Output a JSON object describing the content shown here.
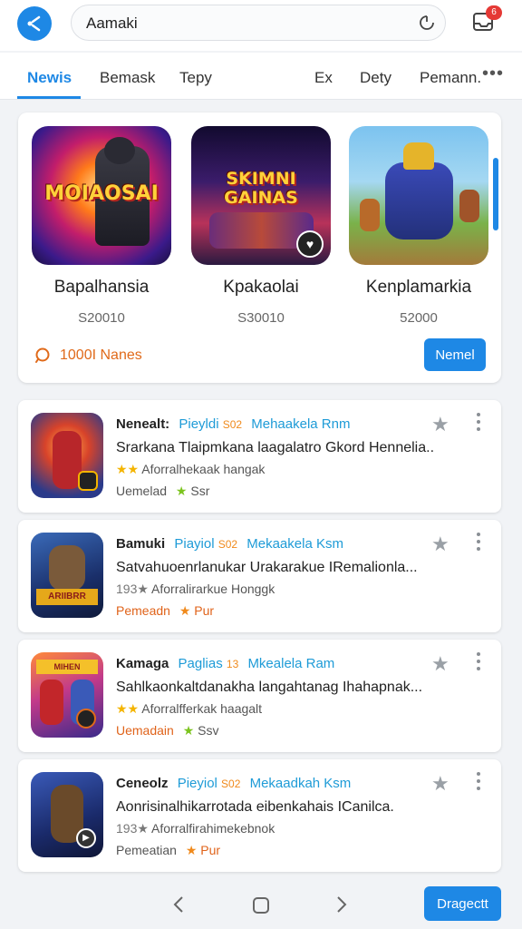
{
  "header": {
    "search_text": "Aamaki",
    "notification_count": "6"
  },
  "tabs": [
    {
      "label": "Newis"
    },
    {
      "label": "Bemask"
    },
    {
      "label": "Tepy"
    },
    {
      "label": "Ex"
    },
    {
      "label": "Dety"
    },
    {
      "label": "Pemann."
    }
  ],
  "featured": {
    "items": [
      {
        "title": "Bapalhansia",
        "price": "S20010",
        "art_text": "MOIAOSAI"
      },
      {
        "title": "Kpakaolai",
        "price": "S30010",
        "art_text": "SKIMNI GAINAS"
      },
      {
        "title": "Kenplamarkia",
        "price": "52000",
        "art_text": ""
      }
    ],
    "names_label": "1000I Nanes",
    "button_label": "Nemel"
  },
  "list": [
    {
      "name": "Nenealt:",
      "tag": "Pieyldi",
      "tag_num": "S02",
      "tag2": "Mehaakela Rnm",
      "description": "Srarkana Tlaipmkana laagalatro Gkord Hennelia...",
      "rating_prefix": "★★",
      "meta": "Aforralhekaak hangak",
      "status": "Uemelad",
      "status_color": "#555555",
      "badge_star": "★",
      "badge_star_color": "#7cc41f",
      "badge": "Ssr"
    },
    {
      "name": "Bamuki",
      "tag": "Piayiol",
      "tag_num": "S02",
      "tag2": "Mekaakela Ksm",
      "description": "Satvahuoenrlanukar Urakarakue IRemalionla...",
      "rating_prefix": "193★",
      "meta": "Aforralirarkue Honggk",
      "status": "Pemeadn",
      "status_color": "#e0631a",
      "badge_star": "★",
      "badge_star_color": "#f08a1c",
      "badge": "Pur"
    },
    {
      "name": "Kamaga",
      "tag": "Paglias",
      "tag_num": "13",
      "tag2": "Mkealela Ram",
      "description": "Sahlkaonkaltdanakha langahtanag Ihahapnak...",
      "rating_prefix": "★★",
      "meta": "Aforralfferkak haagalt",
      "status": "Uemadain",
      "status_color": "#e0631a",
      "badge_star": "★",
      "badge_star_color": "#7cc41f",
      "badge": "Ssv"
    },
    {
      "name": "Ceneolz",
      "tag": "Pieyiol",
      "tag_num": "S02",
      "tag2": "Mekaadkah Ksm",
      "description": "Aonrisinalhikarrotada eibenkahais ICanilca.",
      "rating_prefix": "193★",
      "meta": "Aforralfirahimekebnok",
      "status": "Pemeatian",
      "status_color": "#555555",
      "badge_star": "★",
      "badge_star_color": "#f08a1c",
      "badge": "Pur"
    }
  ],
  "bottom": {
    "button_label": "Dragectt"
  },
  "colors": {
    "accent": "#1e88e5",
    "orange": "#e06a1a"
  }
}
